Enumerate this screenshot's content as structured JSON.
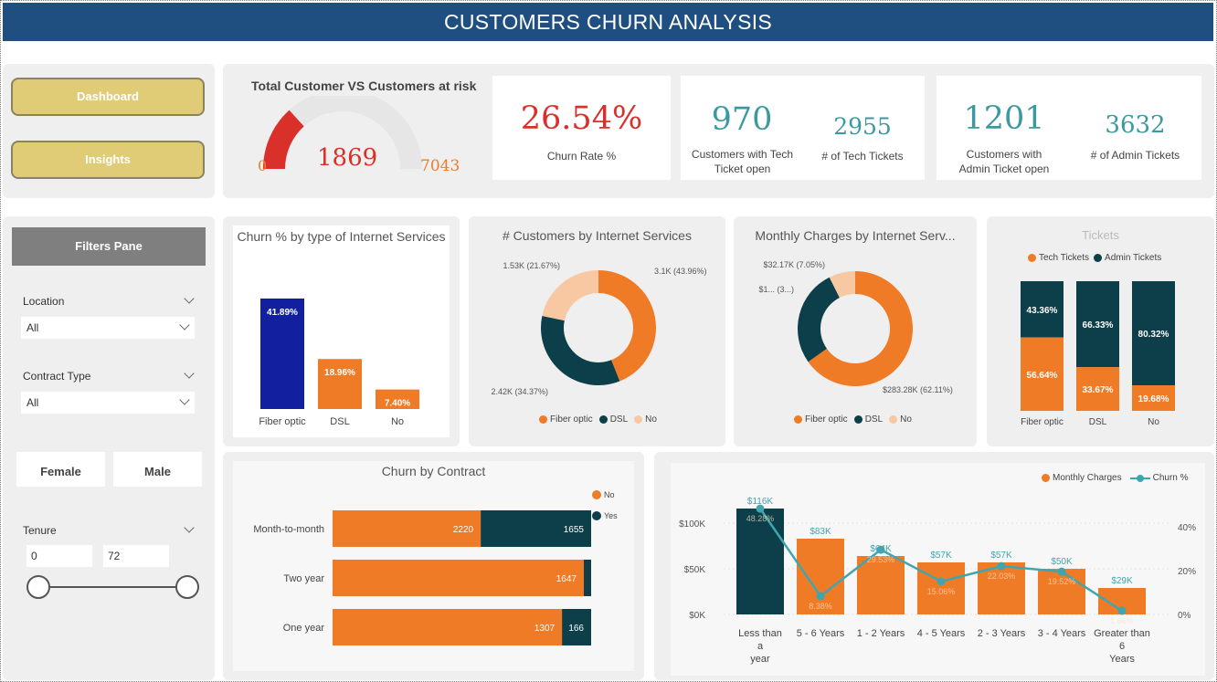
{
  "title": "CUSTOMERS CHURN ANALYSIS",
  "nav": {
    "dashboard": "Dashboard",
    "insights": "Insights"
  },
  "gauge": {
    "title": "Total Customer VS Customers at risk",
    "min": "0",
    "value": "1869",
    "max": "7043",
    "fraction": 0.2654
  },
  "kpi": {
    "churn_rate": "26.54%",
    "churn_rate_label": "Churn Rate %",
    "tech_open": "970",
    "tech_open_label": "Customers with Tech Ticket open",
    "tech_tickets": "2955",
    "tech_tickets_label": "# of Tech Tickets",
    "admin_open": "1201",
    "admin_open_label": "Customers with Admin Ticket open",
    "admin_tickets": "3632",
    "admin_tickets_label": "# of Admin Tickets"
  },
  "filters": {
    "pane_title": "Filters Pane",
    "location_label": "Location",
    "location_value": "All",
    "contract_label": "Contract Type",
    "contract_value": "All",
    "female": "Female",
    "male": "Male",
    "tenure_label": "Tenure",
    "tenure_min": "0",
    "tenure_max": "72"
  },
  "colors": {
    "orange": "#f07b27",
    "teal": "#0d3f4a",
    "navy": "#1220a0",
    "peach": "#f8c8a3",
    "line": "#41a5ae",
    "kpi_red": "#d9312a",
    "kpi_teal": "#3b9aa0",
    "gold": "#e0cc76",
    "header": "#1f4e80"
  },
  "chart_data": [
    {
      "id": "churn_by_internet",
      "type": "bar",
      "title": "Churn % by type of Internet Services",
      "categories": [
        "Fiber optic",
        "DSL",
        "No"
      ],
      "values": [
        41.89,
        18.96,
        7.4
      ],
      "labels": [
        "41.89%",
        "18.96%",
        "7.40%"
      ]
    },
    {
      "id": "customers_by_internet",
      "type": "pie",
      "title": "# Customers by Internet Services",
      "categories": [
        "Fiber optic",
        "DSL",
        "No"
      ],
      "values": [
        3100,
        2420,
        1530
      ],
      "labels": [
        "3.1K (43.96%)",
        "2.42K (34.37%)",
        "1.53K (21.67%)"
      ]
    },
    {
      "id": "monthly_by_internet",
      "type": "pie",
      "title": "Monthly Charges by Internet Serv...",
      "categories": [
        "Fiber optic",
        "DSL",
        "No"
      ],
      "values": [
        283.28,
        118.99,
        32.17
      ],
      "labels": [
        "$283.28K (62.11%)",
        "$1... (3...)",
        "$32.17K (7.05%)"
      ]
    },
    {
      "id": "tickets",
      "type": "bar",
      "title": "Tickets",
      "categories": [
        "Fiber optic",
        "DSL",
        "No"
      ],
      "series": [
        {
          "name": "Tech Tickets",
          "values": [
            56.64,
            33.67,
            19.68
          ]
        },
        {
          "name": "Admin Tickets",
          "values": [
            43.36,
            66.33,
            80.32
          ]
        }
      ]
    },
    {
      "id": "churn_by_contract",
      "type": "bar",
      "title": "Churn by Contract",
      "categories": [
        "Month-to-month",
        "Two year",
        "One year"
      ],
      "series": [
        {
          "name": "No",
          "values": [
            2220,
            1647,
            1307
          ]
        },
        {
          "name": "Yes",
          "values": [
            1655,
            48,
            166
          ]
        }
      ]
    },
    {
      "id": "tenure_combo",
      "type": "bar",
      "categories": [
        "Less than a year",
        "5 - 6 Years",
        "1 - 2 Years",
        "4 - 5 Years",
        "2 - 3 Years",
        "3 - 4 Years",
        "Greater than 6 Years"
      ],
      "series": [
        {
          "name": "Monthly Charges",
          "values": [
            116,
            83,
            64,
            57,
            57,
            50,
            29
          ],
          "labels": [
            "$116K",
            "$83K",
            "$64K",
            "$57K",
            "$57K",
            "$50K",
            "$29K"
          ]
        },
        {
          "name": "Churn %",
          "values": [
            48.28,
            8.38,
            29.53,
            15.06,
            22.03,
            19.52,
            1.66
          ],
          "labels": [
            "48.28%",
            "8.38%",
            "29.53%",
            "15.06%",
            "22.03%",
            "19.52%",
            "1.66%"
          ]
        }
      ],
      "y_ticks": [
        "$100K",
        "$50K",
        "$0K"
      ],
      "y2_ticks": [
        "40%",
        "20%",
        "0%"
      ],
      "ylim": [
        0,
        120
      ],
      "y2lim": [
        0,
        50
      ]
    }
  ]
}
